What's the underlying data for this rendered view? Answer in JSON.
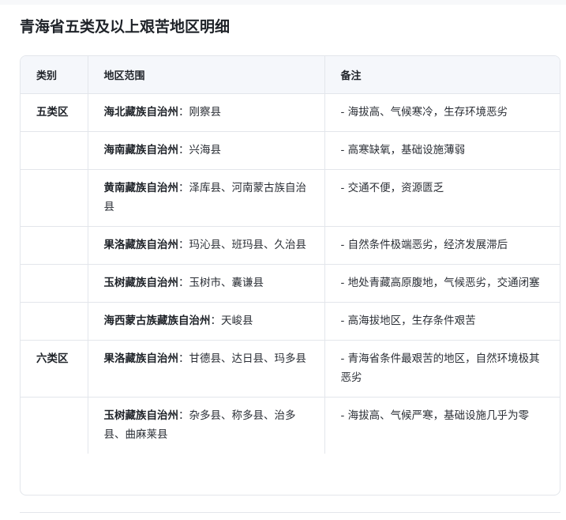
{
  "title": "青海省五类及以上艰苦地区明细",
  "table": {
    "headers": [
      "类别",
      "地区范围",
      "备注"
    ],
    "rows": [
      {
        "category": "五类区",
        "region_name": "海北藏族自治州",
        "sep": "：",
        "region_detail": "刚察县",
        "note": "- 海拔高、气候寒冷，生存环境恶劣"
      },
      {
        "category": "",
        "region_name": "海南藏族自治州",
        "sep": "：",
        "region_detail": "兴海县",
        "note": "- 高寒缺氧，基础设施薄弱"
      },
      {
        "category": "",
        "region_name": "黄南藏族自治州",
        "sep": "：",
        "region_detail": "泽库县、河南蒙古族自治县",
        "note": "- 交通不便，资源匮乏"
      },
      {
        "category": "",
        "region_name": "果洛藏族自治州",
        "sep": "：",
        "region_detail": "玛沁县、班玛县、久治县",
        "note": "- 自然条件极端恶劣，经济发展滞后"
      },
      {
        "category": "",
        "region_name": "玉树藏族自治州",
        "sep": "：",
        "region_detail": "玉树市、囊谦县",
        "note": "- 地处青藏高原腹地，气候恶劣，交通闭塞"
      },
      {
        "category": "",
        "region_name": "海西蒙古族藏族自治州",
        "sep": "：",
        "region_detail": "天峻县",
        "note": "- 高海拔地区，生存条件艰苦"
      },
      {
        "category": "六类区",
        "region_name": "果洛藏族自治州",
        "sep": "：",
        "region_detail": "甘德县、达日县、玛多县",
        "note": "- 青海省条件最艰苦的地区，自然环境极其恶劣"
      },
      {
        "category": "",
        "region_name": "玉树藏族自治州",
        "sep": "：",
        "region_detail": "杂多县、称多县、治多县、曲麻莱县",
        "note": "- 海拔高、气候严寒，基础设施几乎为零"
      }
    ]
  }
}
